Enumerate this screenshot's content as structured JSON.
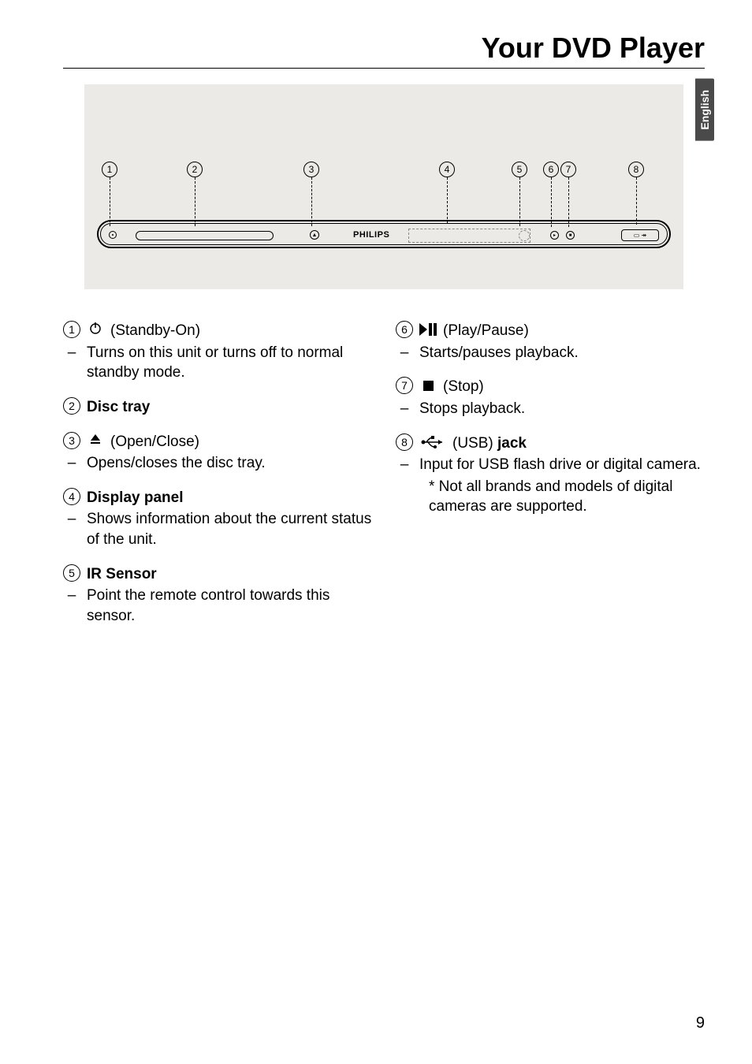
{
  "page": {
    "title": "Your DVD Player",
    "page_number": "9",
    "language_tab": "English"
  },
  "diagram": {
    "brand": "PHILIPS",
    "callouts": [
      "1",
      "2",
      "3",
      "4",
      "5",
      "6",
      "7",
      "8"
    ]
  },
  "left_column": [
    {
      "num": "1",
      "icon": "power-icon",
      "label_plain": " (Standby-On)",
      "desc": "Turns on this unit or turns off to normal standby mode."
    },
    {
      "num": "2",
      "label_bold": "Disc tray"
    },
    {
      "num": "3",
      "icon": "eject-icon",
      "label_plain": " (Open/Close)",
      "desc": "Opens/closes the disc tray."
    },
    {
      "num": "4",
      "label_bold": "Display panel",
      "desc": "Shows information about the current status of the unit."
    },
    {
      "num": "5",
      "label_bold": "IR Sensor",
      "desc": "Point the remote control towards this sensor."
    }
  ],
  "right_column": [
    {
      "num": "6",
      "icon": "play-pause-icon",
      "label_plain": " (Play/Pause)",
      "desc": "Starts/pauses playback."
    },
    {
      "num": "7",
      "icon": "stop-icon",
      "label_plain": " (Stop)",
      "desc": "Stops playback."
    },
    {
      "num": "8",
      "icon": "usb-icon",
      "label_plain_prefix": "  (USB) ",
      "label_bold": "jack",
      "desc": "Input for USB flash drive or digital camera.",
      "note": "*  Not all brands and models of digital cameras are supported."
    }
  ]
}
